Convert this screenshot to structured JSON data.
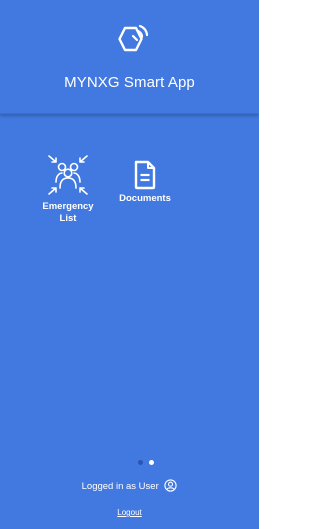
{
  "header": {
    "title": "MYNXG Smart App",
    "logo_icon": "hexagon-nfc-logo-icon"
  },
  "tiles": [
    {
      "label": "Emergency List",
      "icon": "emergency-group-icon"
    },
    {
      "label": "Documents",
      "icon": "document-icon"
    }
  ],
  "pager": {
    "total": 2,
    "active": 2
  },
  "footer": {
    "logged_in_text": "Logged in as User",
    "user_icon": "user-circle-icon",
    "logout_label": "Logout"
  },
  "colors": {
    "background": "#4279e0",
    "text": "#ffffff",
    "active_dot": "#ffffff",
    "inactive_dot": "#2a55b8"
  }
}
